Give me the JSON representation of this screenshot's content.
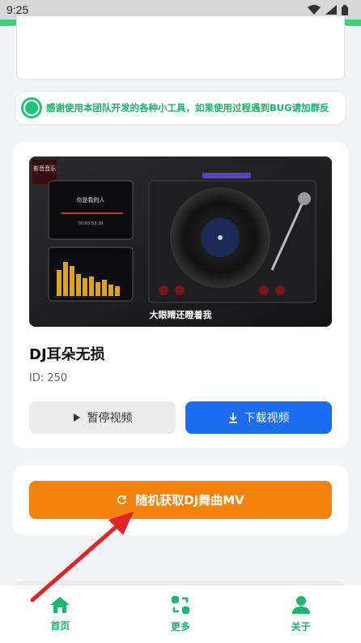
{
  "status_bar": {
    "time": "9:25"
  },
  "notice": {
    "text": "感谢使用本团队开发的各种小工具，如果使用过程遇到BUG请加群反"
  },
  "video": {
    "title": "DJ耳朵无损",
    "id_text": "ID: 250",
    "thumbnail_caption": "大眼睛还瞪着我",
    "thumbnail_logo": "影音音乐",
    "thumbnail_song": "你是我的人",
    "thumbnail_time": "00:03:53:20"
  },
  "buttons": {
    "pause_label": "暂停视频",
    "download_label": "下载视频",
    "random_label": "随机获取DJ舞曲MV"
  },
  "nav": {
    "items": [
      {
        "label": "首页",
        "icon": "home-icon"
      },
      {
        "label": "更多",
        "icon": "more-icon"
      },
      {
        "label": "关于",
        "icon": "user-icon"
      }
    ]
  },
  "colors": {
    "accent_green": "#1fb56f",
    "download_blue": "#1a6cf0",
    "random_orange": "#f5820d",
    "arrow_red": "#e0242a"
  }
}
